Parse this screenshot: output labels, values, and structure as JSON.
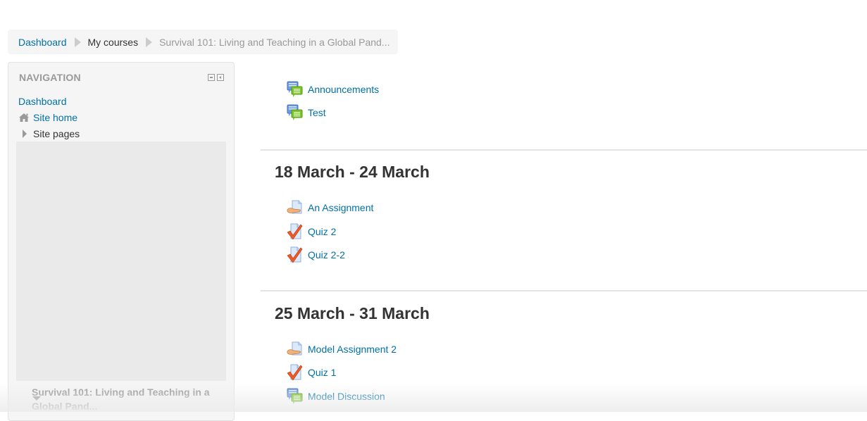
{
  "breadcrumb": {
    "items": [
      {
        "label": "Dashboard",
        "state": "link"
      },
      {
        "label": "My courses",
        "state": "current"
      },
      {
        "label": "Survival 101: Living and Teaching in a Global Pand...",
        "state": "muted"
      }
    ]
  },
  "navigation": {
    "header": "NAVIGATION",
    "controls": {
      "collapse": "collapse-block",
      "dock": "dock-block"
    },
    "items": [
      {
        "label": "Dashboard",
        "icon": null
      },
      {
        "label": "Site home",
        "icon": "home-icon"
      },
      {
        "label": "Site pages",
        "icon": "triangle-right-icon"
      }
    ],
    "current_course": "Survival 101: Living and Teaching in a Global Pand..."
  },
  "main": {
    "top_activities": [
      {
        "label": "Announcements",
        "icon": "forum-icon"
      },
      {
        "label": "Test",
        "icon": "forum-icon"
      }
    ],
    "sections": [
      {
        "title": "18 March - 24 March",
        "activities": [
          {
            "label": "An Assignment",
            "icon": "assignment-icon"
          },
          {
            "label": "Quiz 2",
            "icon": "quiz-icon"
          },
          {
            "label": "Quiz 2-2",
            "icon": "quiz-icon"
          }
        ]
      },
      {
        "title": "25 March - 31 March",
        "activities": [
          {
            "label": "Model Assignment 2",
            "icon": "assignment-icon"
          },
          {
            "label": "Quiz 1",
            "icon": "quiz-icon"
          },
          {
            "label": "Model Discussion",
            "icon": "forum-icon"
          }
        ]
      }
    ]
  },
  "colors": {
    "link": "#0070a8",
    "muted": "#999999",
    "block_bg": "#f5f5f5"
  }
}
